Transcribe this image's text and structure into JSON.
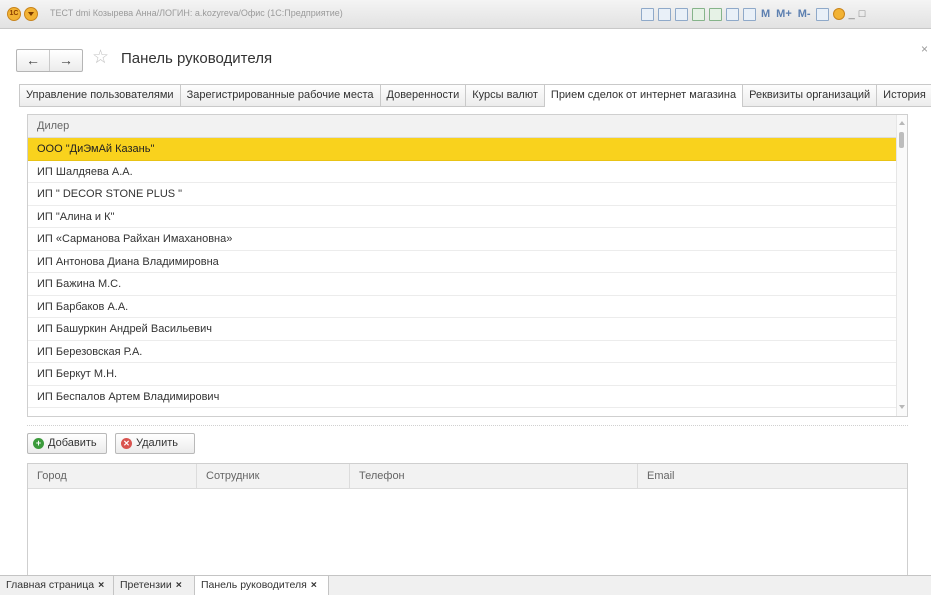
{
  "window": {
    "title": "ТЕСТ dmi Козырева Анна/ЛОГИН: a.kozyreva/Офис (1С:Предприятие)",
    "logo_text": "1С",
    "toolbar_text_buttons": [
      "M",
      "M+",
      "M-"
    ],
    "controls": [
      "_",
      "□"
    ]
  },
  "header": {
    "back_glyph": "←",
    "forward_glyph": "→",
    "favorite_glyph": "☆",
    "title": "Панель руководителя",
    "close_glyph": "×"
  },
  "tabs": [
    {
      "label": "Управление пользователями",
      "active": false
    },
    {
      "label": "Зарегистрированные рабочие места",
      "active": false
    },
    {
      "label": "Доверенности",
      "active": false
    },
    {
      "label": "Курсы валют",
      "active": false
    },
    {
      "label": "Прием сделок от интернет магазина",
      "active": true
    },
    {
      "label": "Реквизиты организаций",
      "active": false
    },
    {
      "label": "История",
      "active": false
    }
  ],
  "dealers": {
    "column": "Дилер",
    "selected_index": 0,
    "rows": [
      "ООО \"ДиЭмАй Казань\"",
      "ИП  Шалдяева А.А.",
      "ИП \" DECOR STONE PLUS \"",
      "ИП \"Алина и К\"",
      "ИП «Сарманова Райхан Имахановна»",
      "ИП Антонова Диана Владимировна",
      "ИП Бажина М.С.",
      "ИП Барбаков А.А.",
      "ИП Башуркин Андрей Васильевич",
      "ИП Березовская Р.А.",
      "ИП Беркут М.Н.",
      "ИП Беспалов Артем Владимирович"
    ]
  },
  "buttons": {
    "add": "Добавить",
    "delete": "Удалить"
  },
  "contacts": {
    "columns": [
      "Город",
      "Сотрудник",
      "Телефон",
      "Email"
    ]
  },
  "open_windows": [
    {
      "label": "Главная страница",
      "close": "×"
    },
    {
      "label": "Претензии",
      "close": "×"
    },
    {
      "label": "Панель руководителя",
      "close": "×",
      "active": true
    }
  ],
  "colors": {
    "selection": "#f9d21d",
    "add_icon": "#3b9a3b",
    "delete_icon": "#d9534f"
  }
}
